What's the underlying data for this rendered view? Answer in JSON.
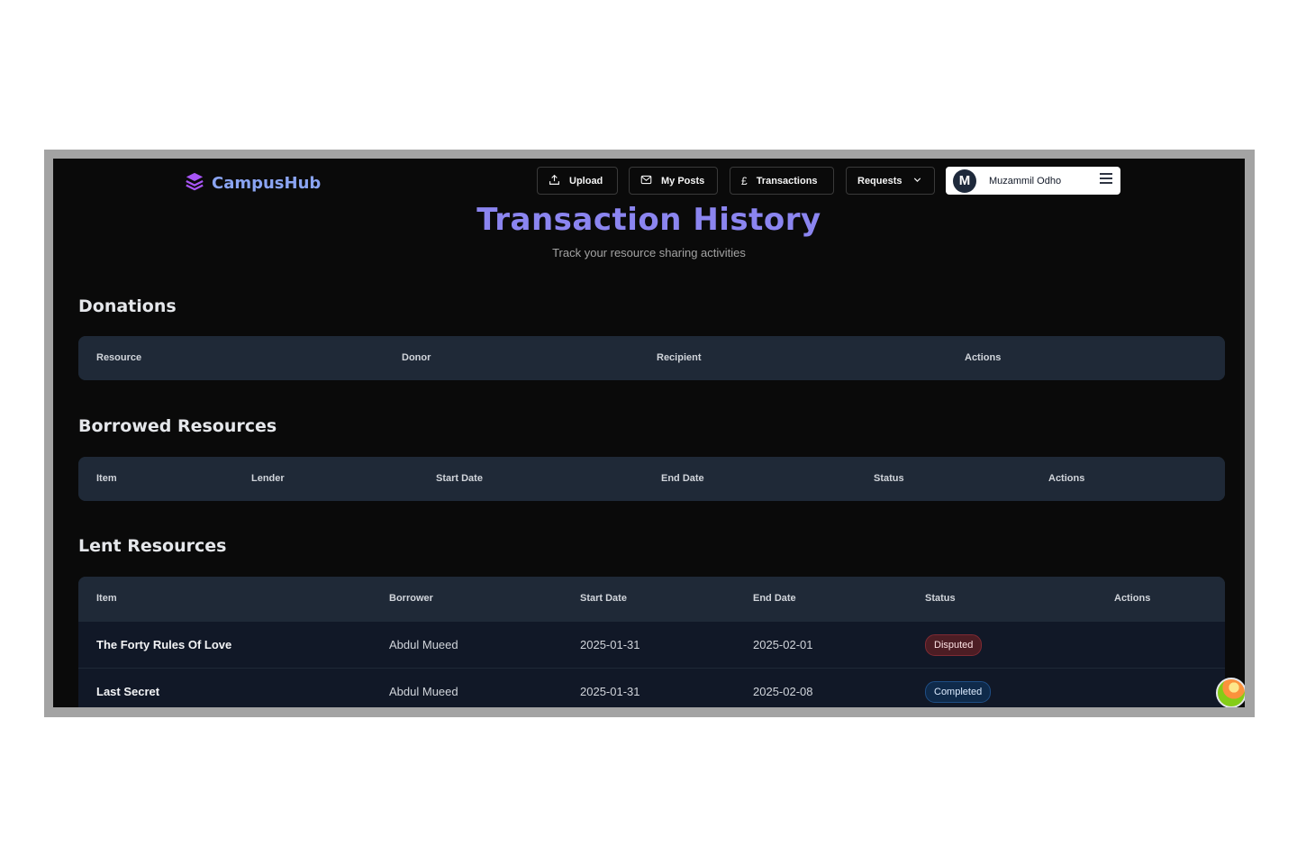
{
  "app": {
    "brand": "CampusHub"
  },
  "nav": {
    "upload": "Upload",
    "my_posts": "My Posts",
    "transactions": "Transactions",
    "requests": "Requests",
    "user_initial": "M",
    "user_name": "Muzammil Odho"
  },
  "page": {
    "title": "Transaction History",
    "subtitle": "Track your resource sharing activities"
  },
  "donations": {
    "title": "Donations",
    "headers": [
      "Resource",
      "Donor",
      "Recipient",
      "Actions"
    ]
  },
  "borrowed": {
    "title": "Borrowed Resources",
    "headers": [
      "Item",
      "Lender",
      "Start Date",
      "End Date",
      "Status",
      "Actions"
    ]
  },
  "lent": {
    "title": "Lent Resources",
    "headers": [
      "Item",
      "Borrower",
      "Start Date",
      "End Date",
      "Status",
      "Actions"
    ],
    "rows": [
      {
        "item": "The Forty Rules Of Love",
        "borrower": "Abdul Mueed",
        "start": "2025-01-31",
        "end": "2025-02-01",
        "status": "Disputed"
      },
      {
        "item": "Last Secret",
        "borrower": "Abdul Mueed",
        "start": "2025-01-31",
        "end": "2025-02-08",
        "status": "Completed"
      }
    ]
  },
  "colors": {
    "accent": "#8b85f0",
    "brand_icon": "#a855f7",
    "disputed": "#4c1d24",
    "completed": "#0f2a4a"
  }
}
